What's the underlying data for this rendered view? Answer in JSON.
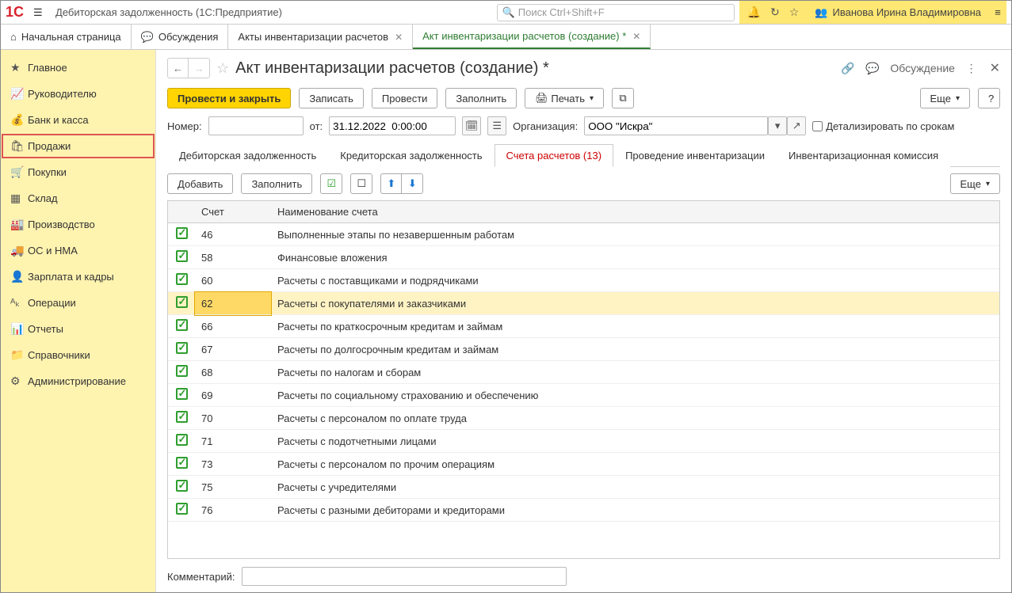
{
  "titlebar": {
    "app_title": "Дебиторская задолженность  (1С:Предприятие)",
    "search_placeholder": "Поиск Ctrl+Shift+F",
    "user_name": "Иванова Ирина Владимировна"
  },
  "tabs": {
    "home": "Начальная страница",
    "discussions": "Обсуждения",
    "invacts": "Акты инвентаризации расчетов",
    "current": "Акт инвентаризации расчетов (создание) *"
  },
  "sidebar": [
    {
      "label": "Главное",
      "icon": "★"
    },
    {
      "label": "Руководителю",
      "icon": "📈"
    },
    {
      "label": "Банк и касса",
      "icon": "💰"
    },
    {
      "label": "Продажи",
      "icon": "🛍",
      "selected": true
    },
    {
      "label": "Покупки",
      "icon": "🛒"
    },
    {
      "label": "Склад",
      "icon": "▦"
    },
    {
      "label": "Производство",
      "icon": "🏭"
    },
    {
      "label": "ОС и НМА",
      "icon": "🚚"
    },
    {
      "label": "Зарплата и кадры",
      "icon": "👤"
    },
    {
      "label": "Операции",
      "icon": "ᴬₖ"
    },
    {
      "label": "Отчеты",
      "icon": "📊"
    },
    {
      "label": "Справочники",
      "icon": "📁"
    },
    {
      "label": "Администрирование",
      "icon": "⚙"
    }
  ],
  "doc": {
    "title": "Акт инвентаризации расчетов (создание) *",
    "discussion": "Обсуждение"
  },
  "toolbar": {
    "post_close": "Провести и закрыть",
    "save": "Записать",
    "post": "Провести",
    "fill": "Заполнить",
    "print": "Печать",
    "more": "Еще"
  },
  "form": {
    "number_label": "Номер:",
    "number_value": "",
    "from_label": "от:",
    "date_value": "31.12.2022  0:00:00",
    "org_label": "Организация:",
    "org_value": "ООО \"Искра\"",
    "detail_label": "Детализировать по срокам"
  },
  "subtabs": {
    "deb": "Дебиторская задолженность",
    "kred": "Кредиторская задолженность",
    "accounts": "Счета расчетов (13)",
    "inv": "Проведение инвентаризации",
    "comm": "Инвентаризационная комиссия"
  },
  "tab_toolbar": {
    "add": "Добавить",
    "fill": "Заполнить",
    "more": "Еще"
  },
  "grid": {
    "col_account": "Счет",
    "col_name": "Наименование счета",
    "rows": [
      {
        "acct": "46",
        "name": "Выполненные этапы по незавершенным работам"
      },
      {
        "acct": "58",
        "name": "Финансовые вложения"
      },
      {
        "acct": "60",
        "name": "Расчеты с поставщиками и подрядчиками"
      },
      {
        "acct": "62",
        "name": "Расчеты с покупателями и заказчиками",
        "selected": true
      },
      {
        "acct": "66",
        "name": "Расчеты по краткосрочным кредитам и займам"
      },
      {
        "acct": "67",
        "name": "Расчеты по долгосрочным кредитам и займам"
      },
      {
        "acct": "68",
        "name": "Расчеты по налогам и сборам"
      },
      {
        "acct": "69",
        "name": "Расчеты по социальному страхованию и обеспечению"
      },
      {
        "acct": "70",
        "name": "Расчеты с персоналом по оплате труда"
      },
      {
        "acct": "71",
        "name": "Расчеты с подотчетными лицами"
      },
      {
        "acct": "73",
        "name": "Расчеты с персоналом по прочим операциям"
      },
      {
        "acct": "75",
        "name": "Расчеты с учредителями"
      },
      {
        "acct": "76",
        "name": "Расчеты с разными дебиторами и кредиторами"
      }
    ]
  },
  "footer": {
    "comment_label": "Комментарий:",
    "comment_value": ""
  }
}
